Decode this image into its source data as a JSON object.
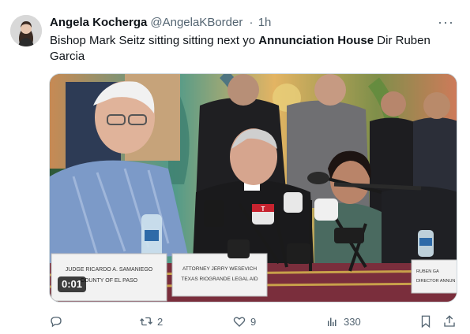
{
  "tweet": {
    "author_name": "Angela Kocherga",
    "handle": "@AngelaKBorder",
    "separator": "·",
    "time": "1h",
    "more_label": "···",
    "text_part1": "Bishop Mark Seitz sitting sitting next yo ",
    "text_bold": "Annunciation House",
    "text_part2": " Dir Ruben Garcia"
  },
  "media": {
    "timer": "0:01",
    "placards": {
      "left_line1": "JUDGE RICARDO A. SAMANIEGO",
      "left_line2": "COUNTY OF EL PASO",
      "mid_line1": "ATTORNEY JERRY WESEVICH",
      "mid_line2": "TEXAS RIOGRANDE LEGAL AID",
      "right_line1": "RUBEN GA",
      "right_line2": "DIRECTOR ANNUN"
    },
    "mic_logo": "T"
  },
  "actions": {
    "reply_count": "",
    "retweet_count": "2",
    "like_count": "9",
    "views_count": "330"
  }
}
